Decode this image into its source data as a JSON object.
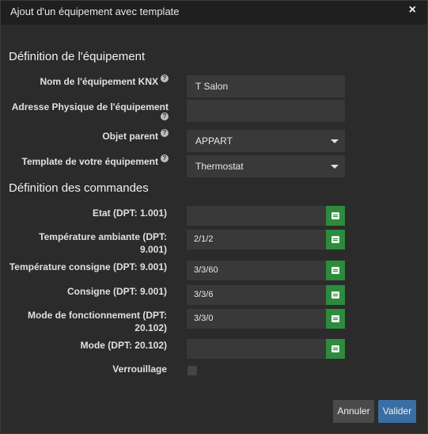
{
  "dialog": {
    "title": "Ajout d'un équipement avec template",
    "close_label": "×"
  },
  "equipment": {
    "section_title": "Définition de l'équipement",
    "fields": [
      {
        "label": "Nom de l'équipement KNX",
        "value": "T Salon",
        "help": "?"
      },
      {
        "label": "Adresse Physique de l'équipement",
        "value": "",
        "help": "?"
      },
      {
        "label": "Objet parent",
        "value": "APPART",
        "help": "?"
      },
      {
        "label": "Template de votre équipement",
        "value": "Thermostat",
        "help": "?"
      }
    ]
  },
  "commands": {
    "section_title": "Définition des commandes",
    "rows": [
      {
        "label": "Etat (DPT: 1.001)",
        "value": ""
      },
      {
        "label_line1": "Température ambiante (DPT:",
        "label_line2": "9.001)",
        "value": "2/1/2"
      },
      {
        "label": "Température consigne (DPT: 9.001)",
        "value": "3/3/60"
      },
      {
        "label": "Consigne (DPT: 9.001)",
        "value": "3/3/6"
      },
      {
        "label_line1": "Mode de fonctionnement (DPT:",
        "label_line2": "20.102)",
        "value": "3/3/0"
      },
      {
        "label": "Mode (DPT: 20.102)",
        "value": ""
      }
    ],
    "lock_label": "Verrouillage",
    "lock_checked": false
  },
  "footer": {
    "cancel_label": "Annuler",
    "ok_label": "Valider"
  },
  "colors": {
    "accent_green": "#2e8b3e",
    "primary_blue": "#3a6ea5",
    "background": "#2b2b2b"
  }
}
